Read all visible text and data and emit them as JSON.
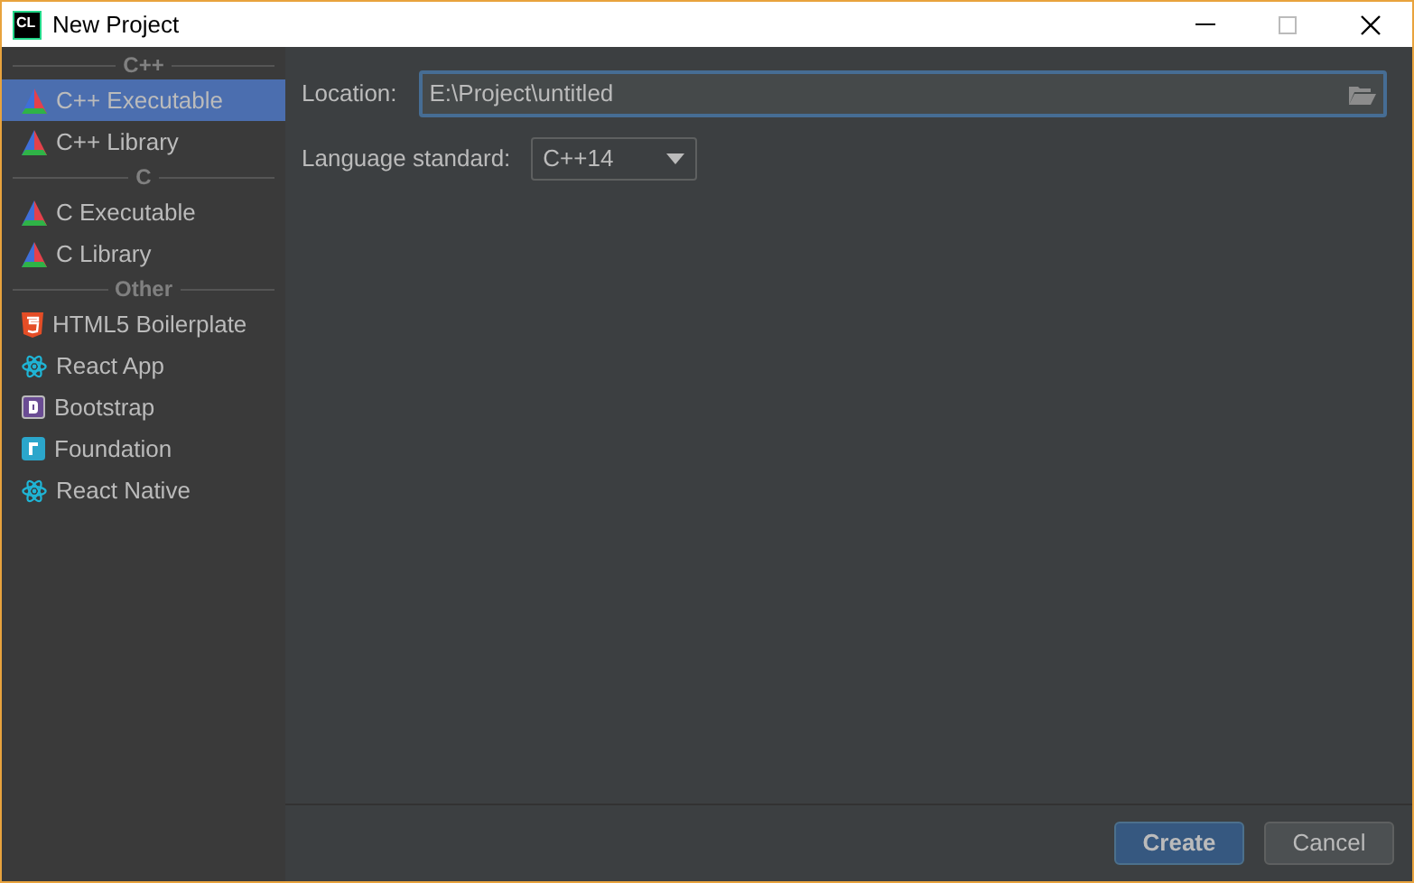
{
  "window": {
    "logo": "CL",
    "title": "New Project"
  },
  "sidebar": {
    "sections": [
      {
        "header": "C++",
        "items": [
          {
            "label": "C++ Executable",
            "kind": "clion",
            "selected": true
          },
          {
            "label": "C++ Library",
            "kind": "clion",
            "selected": false
          }
        ]
      },
      {
        "header": "C",
        "items": [
          {
            "label": "C Executable",
            "kind": "clion",
            "selected": false
          },
          {
            "label": "C Library",
            "kind": "clion",
            "selected": false
          }
        ]
      },
      {
        "header": "Other",
        "items": [
          {
            "label": "HTML5 Boilerplate",
            "kind": "html5",
            "selected": false
          },
          {
            "label": "React App",
            "kind": "react",
            "selected": false
          },
          {
            "label": "Bootstrap",
            "kind": "bootstrap",
            "selected": false
          },
          {
            "label": "Foundation",
            "kind": "foundation",
            "selected": false
          },
          {
            "label": "React Native",
            "kind": "react",
            "selected": false
          }
        ]
      }
    ]
  },
  "form": {
    "location": {
      "label": "Location:",
      "value": "E:\\Project\\untitled"
    },
    "language_standard": {
      "label": "Language standard:",
      "value": "C++14"
    }
  },
  "buttons": [
    {
      "label": "Create",
      "kind": "primary"
    },
    {
      "label": "Cancel",
      "kind": "secondary"
    }
  ]
}
